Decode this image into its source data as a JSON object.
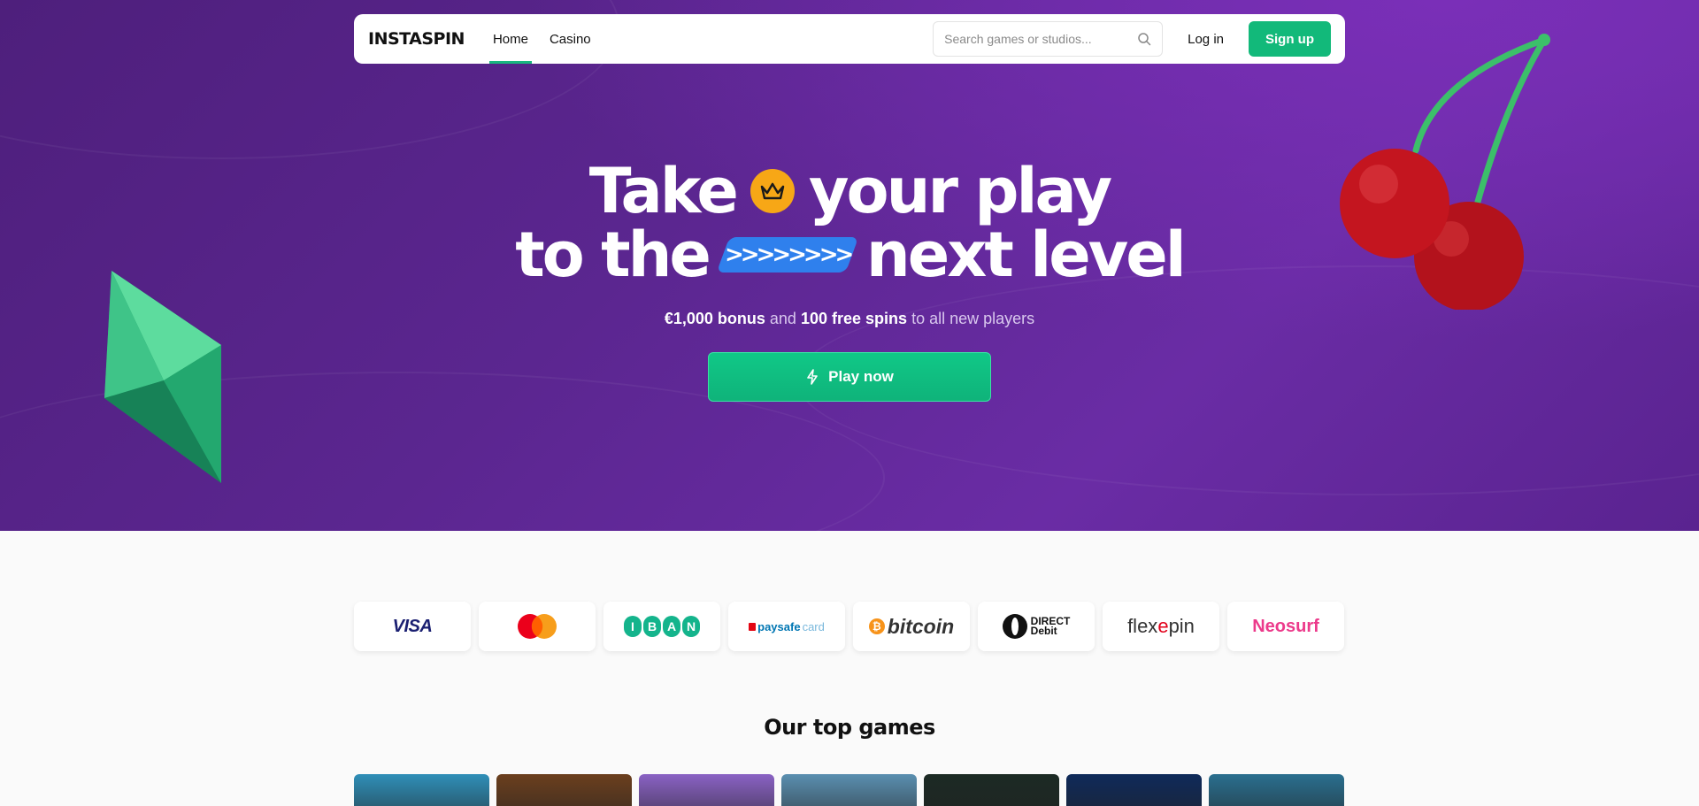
{
  "nav": {
    "logo": "INSTASPIN",
    "links": [
      {
        "label": "Home",
        "active": true
      },
      {
        "label": "Casino",
        "active": false
      }
    ],
    "search_placeholder": "Search games or studios...",
    "login_label": "Log in",
    "signup_label": "Sign up"
  },
  "hero": {
    "line1_a": "Take",
    "line1_b": "your play",
    "line2_a": "to the",
    "line2_b": "next level",
    "arrows": ">>>>>>>>",
    "sub_bonus": "€1,000 bonus",
    "sub_and": "and",
    "sub_spins": "100 free spins",
    "sub_rest": "to all new players",
    "cta_label": "Play now"
  },
  "payments": [
    {
      "name": "VISA"
    },
    {
      "name": "Mastercard"
    },
    {
      "name": "IBAN",
      "letters": [
        "I",
        "B",
        "A",
        "N"
      ]
    },
    {
      "name": "paysafecard",
      "a": "paysafe",
      "b": "card"
    },
    {
      "name": "bitcoin"
    },
    {
      "name": "Direct Debit",
      "a": "DIRECT",
      "b": "Debit"
    },
    {
      "name": "flexepin",
      "a": "flex",
      "b": "e",
      "c": "pin"
    },
    {
      "name": "Neosurf"
    }
  ],
  "top_games": {
    "title": "Our top games",
    "tiles": [
      {
        "color": "#2f8fb8"
      },
      {
        "color": "#6b3f1e"
      },
      {
        "color": "#8a62c4"
      },
      {
        "color": "#5a8fb0"
      },
      {
        "color": "#1c2a24"
      },
      {
        "color": "#0f2a5a"
      },
      {
        "color": "#2a6f8f"
      }
    ]
  },
  "colors": {
    "accent": "#12b97a",
    "hero_bg": "#5b2690",
    "crown": "#f7a716",
    "arrow_badge": "#2f80ed"
  }
}
